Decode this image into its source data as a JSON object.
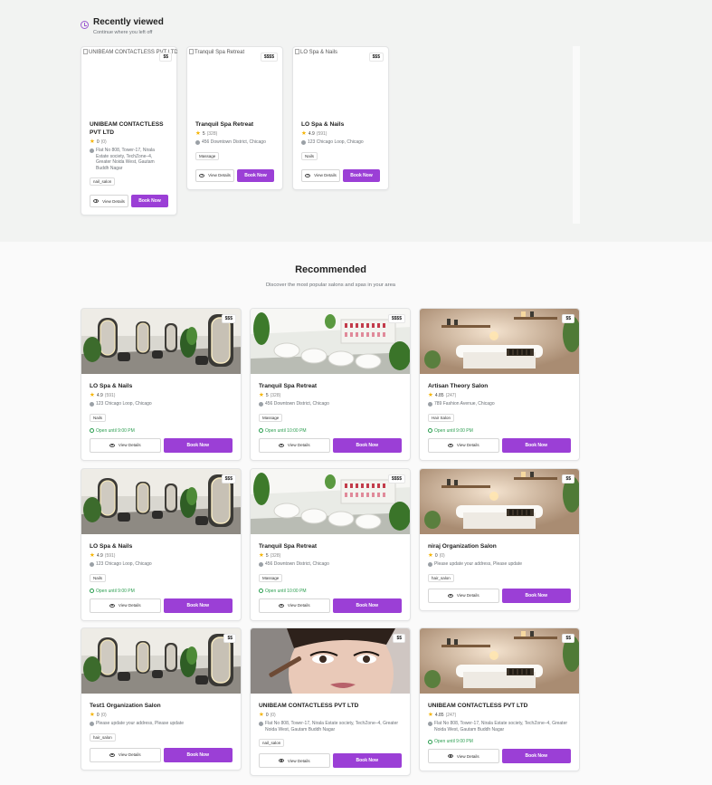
{
  "recently_viewed": {
    "title": "Recently viewed",
    "subtitle": "Continue where you left off",
    "cards": [
      {
        "alt": "UNIBEAM CONTACTLESS PVT LTD",
        "price": "$$",
        "name": "UNIBEAM CONTACTLESS PVT LTD",
        "rating": "0",
        "reviews": "(0)",
        "address": "Flat No 808, Tower-17, Nirala Estate society, TechZone–4, Greater Noida West, Gautam Buddh Nagar",
        "tag": "nail_salon",
        "view": "View Details",
        "book": "Book Now"
      },
      {
        "alt": "Tranquil Spa Retreat",
        "price": "$$$$",
        "name": "Tranquil Spa Retreat",
        "rating": "5",
        "reviews": "(328)",
        "address": "456 Downtown District, Chicago",
        "tag": "Massage",
        "view": "View Details",
        "book": "Book Now"
      },
      {
        "alt": "LO Spa & Nails",
        "price": "$$$",
        "name": "LO Spa & Nails",
        "rating": "4.9",
        "reviews": "(591)",
        "address": "123 Chicago Loop, Chicago",
        "tag": "Nails",
        "view": "View Details",
        "book": "Book Now"
      }
    ]
  },
  "recommended": {
    "title": "Recommended",
    "subtitle": "Discover the most popular salons and spas in your area",
    "cards": [
      {
        "image": "salon",
        "price": "$$$",
        "name": "LO Spa & Nails",
        "rating": "4.9",
        "reviews": "(591)",
        "address": "123 Chicago Loop, Chicago",
        "tag": "Nails",
        "open": "Open until 9:00 PM",
        "view": "View Details",
        "book": "Book Now"
      },
      {
        "image": "nail",
        "price": "$$$$",
        "name": "Tranquil Spa Retreat",
        "rating": "5",
        "reviews": "(328)",
        "address": "456 Downtown District, Chicago",
        "tag": "Massage",
        "open": "Open until 10:00 PM",
        "view": "View Details",
        "book": "Book Now"
      },
      {
        "image": "spa",
        "price": "$$",
        "name": "Artisan Theory Salon",
        "rating": "4.85",
        "reviews": "(247)",
        "address": "789 Fashion Avenue, Chicago",
        "tag": "Hair Salon",
        "open": "Open until 9:00 PM",
        "view": "View Details",
        "book": "Book Now"
      },
      {
        "image": "salon",
        "price": "$$$",
        "name": "LO Spa & Nails",
        "rating": "4.9",
        "reviews": "(591)",
        "address": "123 Chicago Loop, Chicago",
        "tag": "Nails",
        "open": "Open until 9:00 PM",
        "view": "View Details",
        "book": "Book Now"
      },
      {
        "image": "nail",
        "price": "$$$$",
        "name": "Tranquil Spa Retreat",
        "rating": "5",
        "reviews": "(328)",
        "address": "456 Downtown District, Chicago",
        "tag": "Massage",
        "open": "Open until 10:00 PM",
        "view": "View Details",
        "book": "Book Now"
      },
      {
        "image": "spa",
        "price": "$$",
        "name": "niraj Organization Salon",
        "rating": "0",
        "reviews": "(0)",
        "address": "Please update your address, Please update",
        "tag": "hair_salon",
        "open": "",
        "view": "View Details",
        "book": "Book Now"
      },
      {
        "image": "salon",
        "price": "$$",
        "name": "Test1 Organization Salon",
        "rating": "0",
        "reviews": "(0)",
        "address": "Please update your address, Please update",
        "tag": "hair_salon",
        "open": "",
        "view": "View Details",
        "book": "Book Now"
      },
      {
        "image": "makeup",
        "price": "$$",
        "name": "UNIBEAM CONTACTLESS PVT LTD",
        "rating": "0",
        "reviews": "(0)",
        "address": "Flat No 808, Tower-17, Nirala Estate society, TechZone–4, Greater Noida West, Gautam Buddh Nagar",
        "tag": "nail_salon",
        "open": "",
        "view": "View Details",
        "book": "Book Now"
      },
      {
        "image": "spa",
        "price": "$$",
        "name": "UNIBEAM CONTACTLESS PVT LTD",
        "rating": "4.85",
        "reviews": "(247)",
        "address": "Flat No 808, Tower-17, Nirala Estate society, TechZone–4, Greater Noida West, Gautam Buddh Nagar",
        "tag": "",
        "open": "Open until 9:00 PM",
        "view": "View Details",
        "book": "Book Now"
      }
    ]
  },
  "colors": {
    "accent": "#9b3fd6",
    "open_green": "#2a9d4f",
    "star": "#f5b301"
  },
  "icons": [
    "clock-icon",
    "star-icon",
    "location-pin-icon",
    "eye-icon",
    "open-clock-icon"
  ]
}
